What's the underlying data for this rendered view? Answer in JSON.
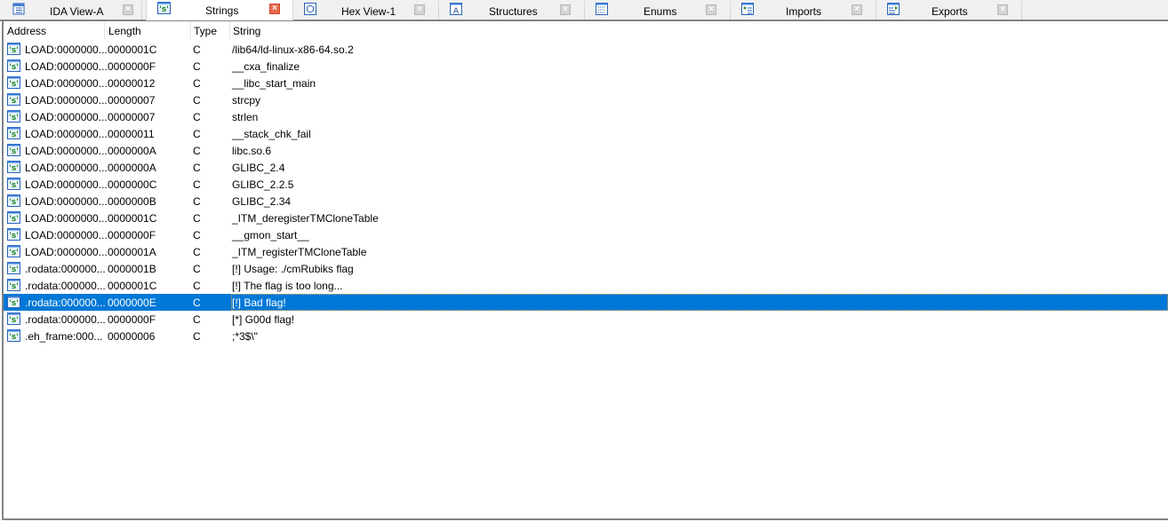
{
  "tabs": [
    {
      "label": "IDA View-A",
      "icon": "ida-view-icon",
      "active": false
    },
    {
      "label": "Strings",
      "icon": "strings-icon",
      "active": true
    },
    {
      "label": "Hex View-1",
      "icon": "hex-view-icon",
      "active": false
    },
    {
      "label": "Structures",
      "icon": "structures-icon",
      "active": false
    },
    {
      "label": "Enums",
      "icon": "enums-icon",
      "active": false
    },
    {
      "label": "Imports",
      "icon": "imports-icon",
      "active": false
    },
    {
      "label": "Exports",
      "icon": "exports-icon",
      "active": false
    }
  ],
  "table": {
    "columns": [
      "Address",
      "Length",
      "Type",
      "String"
    ],
    "selected_index": 15,
    "rows": [
      {
        "address": "LOAD:0000000...",
        "length": "0000001C",
        "type": "C",
        "string": "/lib64/ld-linux-x86-64.so.2"
      },
      {
        "address": "LOAD:0000000...",
        "length": "0000000F",
        "type": "C",
        "string": "__cxa_finalize"
      },
      {
        "address": "LOAD:0000000...",
        "length": "00000012",
        "type": "C",
        "string": "__libc_start_main"
      },
      {
        "address": "LOAD:0000000...",
        "length": "00000007",
        "type": "C",
        "string": "strcpy"
      },
      {
        "address": "LOAD:0000000...",
        "length": "00000007",
        "type": "C",
        "string": "strlen"
      },
      {
        "address": "LOAD:0000000...",
        "length": "00000011",
        "type": "C",
        "string": "__stack_chk_fail"
      },
      {
        "address": "LOAD:0000000...",
        "length": "0000000A",
        "type": "C",
        "string": "libc.so.6"
      },
      {
        "address": "LOAD:0000000...",
        "length": "0000000A",
        "type": "C",
        "string": "GLIBC_2.4"
      },
      {
        "address": "LOAD:0000000...",
        "length": "0000000C",
        "type": "C",
        "string": "GLIBC_2.2.5"
      },
      {
        "address": "LOAD:0000000...",
        "length": "0000000B",
        "type": "C",
        "string": "GLIBC_2.34"
      },
      {
        "address": "LOAD:0000000...",
        "length": "0000001C",
        "type": "C",
        "string": "_ITM_deregisterTMCloneTable"
      },
      {
        "address": "LOAD:0000000...",
        "length": "0000000F",
        "type": "C",
        "string": "__gmon_start__"
      },
      {
        "address": "LOAD:0000000...",
        "length": "0000001A",
        "type": "C",
        "string": "_ITM_registerTMCloneTable"
      },
      {
        "address": ".rodata:000000...",
        "length": "0000001B",
        "type": "C",
        "string": "[!] Usage: ./cmRubiks flag"
      },
      {
        "address": ".rodata:000000...",
        "length": "0000001C",
        "type": "C",
        "string": "[!] The flag is too long..."
      },
      {
        "address": ".rodata:000000...",
        "length": "0000000E",
        "type": "C",
        "string": "[!] Bad flag!"
      },
      {
        "address": ".rodata:000000...",
        "length": "0000000F",
        "type": "C",
        "string": "[*] G00d flag!"
      },
      {
        "address": ".eh_frame:000...",
        "length": "00000006",
        "type": "C",
        "string": ";*3$\\\""
      }
    ]
  },
  "colors": {
    "selection": "#0078d7",
    "active_close": "#e86a4f",
    "tabbar_bg": "#f0f0f0"
  }
}
